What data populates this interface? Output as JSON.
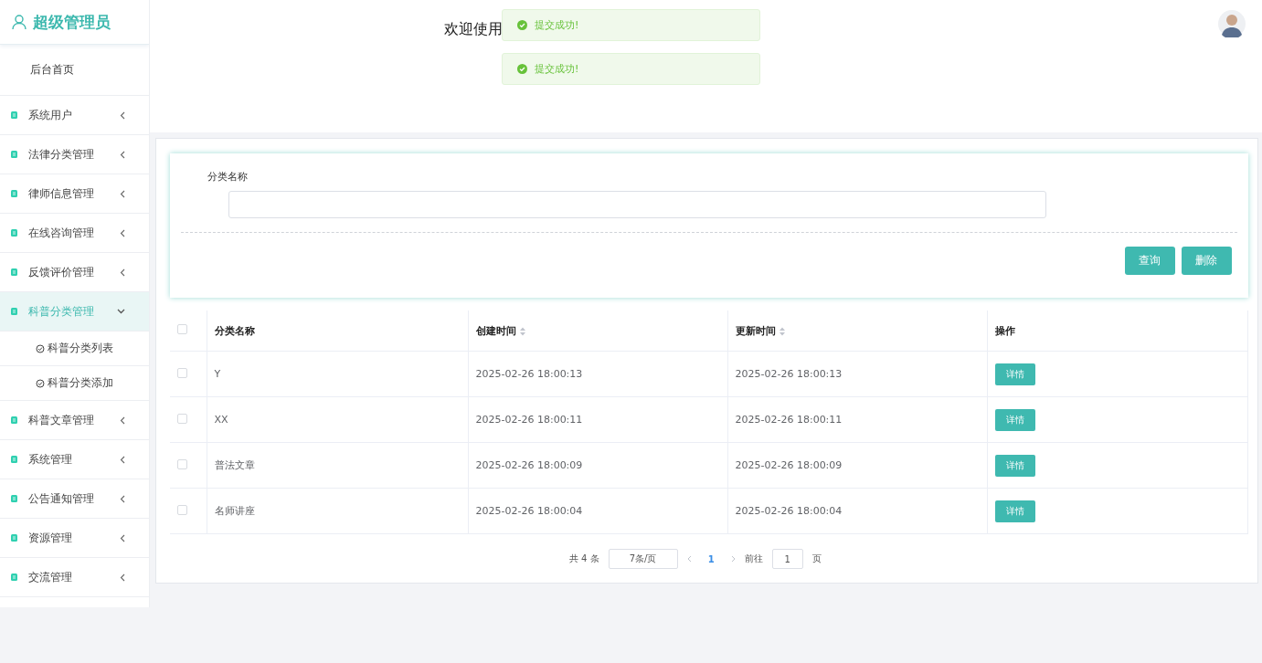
{
  "sidebar": {
    "title": "超级管理员",
    "items": [
      {
        "label": "后台首页",
        "kind": "link"
      },
      {
        "label": "系统用户",
        "kind": "menu",
        "expanded": false
      },
      {
        "label": "法律分类管理",
        "kind": "menu",
        "expanded": false
      },
      {
        "label": "律师信息管理",
        "kind": "menu",
        "expanded": false
      },
      {
        "label": "在线咨询管理",
        "kind": "menu",
        "expanded": false
      },
      {
        "label": "反馈评价管理",
        "kind": "menu",
        "expanded": false
      },
      {
        "label": "科普分类管理",
        "kind": "menu",
        "expanded": true,
        "children": [
          {
            "label": "科普分类列表"
          },
          {
            "label": "科普分类添加"
          }
        ]
      },
      {
        "label": "科普文章管理",
        "kind": "menu",
        "expanded": false
      },
      {
        "label": "系统管理",
        "kind": "menu",
        "expanded": false
      },
      {
        "label": "公告通知管理",
        "kind": "menu",
        "expanded": false
      },
      {
        "label": "资源管理",
        "kind": "menu",
        "expanded": false
      },
      {
        "label": "交流管理",
        "kind": "menu",
        "expanded": false
      }
    ]
  },
  "header": {
    "welcome": "欢迎使用"
  },
  "toasts": [
    {
      "text": "提交成功!"
    },
    {
      "text": "提交成功!"
    }
  ],
  "search": {
    "label": "分类名称",
    "buttons": [
      {
        "label": "查询"
      },
      {
        "label": "删除"
      }
    ]
  },
  "table": {
    "columns": [
      {
        "label": "分类名称",
        "sortable": false
      },
      {
        "label": "创建时间",
        "sortable": true
      },
      {
        "label": "更新时间",
        "sortable": true
      },
      {
        "label": "操作",
        "sortable": false
      }
    ],
    "all_checked": false,
    "rows": [
      {
        "checked": false,
        "name": "Y",
        "created": "2025-02-26 18:00:13",
        "updated": "2025-02-26 18:00:13",
        "action": "详情"
      },
      {
        "checked": false,
        "name": "XX",
        "created": "2025-02-26 18:00:11",
        "updated": "2025-02-26 18:00:11",
        "action": "详情"
      },
      {
        "checked": false,
        "name": "普法文章",
        "created": "2025-02-26 18:00:09",
        "updated": "2025-02-26 18:00:09",
        "action": "详情"
      },
      {
        "checked": false,
        "name": "名师讲座",
        "created": "2025-02-26 18:00:04",
        "updated": "2025-02-26 18:00:04",
        "action": "详情"
      }
    ]
  },
  "pagination": {
    "total": "共 4 条",
    "page_size": "7条/页",
    "pages": [
      {
        "label": "1",
        "selected": true
      }
    ],
    "goto": "前往",
    "goto_value": "1",
    "suffix": "页"
  }
}
